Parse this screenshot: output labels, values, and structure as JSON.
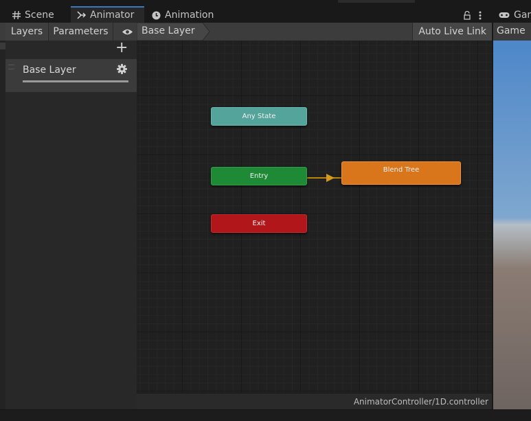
{
  "tabs": {
    "scene": "Scene",
    "animator": "Animator",
    "animation": "Animation",
    "game": "Gam"
  },
  "toolbar": {
    "layers": "Layers",
    "parameters": "Parameters",
    "breadcrumb": "Base Layer",
    "auto_live_link": "Auto Live Link"
  },
  "game_panel": {
    "tab_label": "Game"
  },
  "layers_panel": {
    "add_symbol": "+",
    "items": [
      {
        "name": "Base Layer",
        "weight": 1.0
      }
    ]
  },
  "graph": {
    "nodes": {
      "any_state": "Any State",
      "entry": "Entry",
      "exit": "Exit",
      "blend_tree": "Blend Tree"
    }
  },
  "status": {
    "path": "AnimatorController/1D.controller"
  },
  "colors": {
    "any_state": "#55a49b",
    "entry": "#1f8a36",
    "exit": "#b0161a",
    "blend_tree": "#d9761c",
    "active_tab": "#3a79bb"
  }
}
